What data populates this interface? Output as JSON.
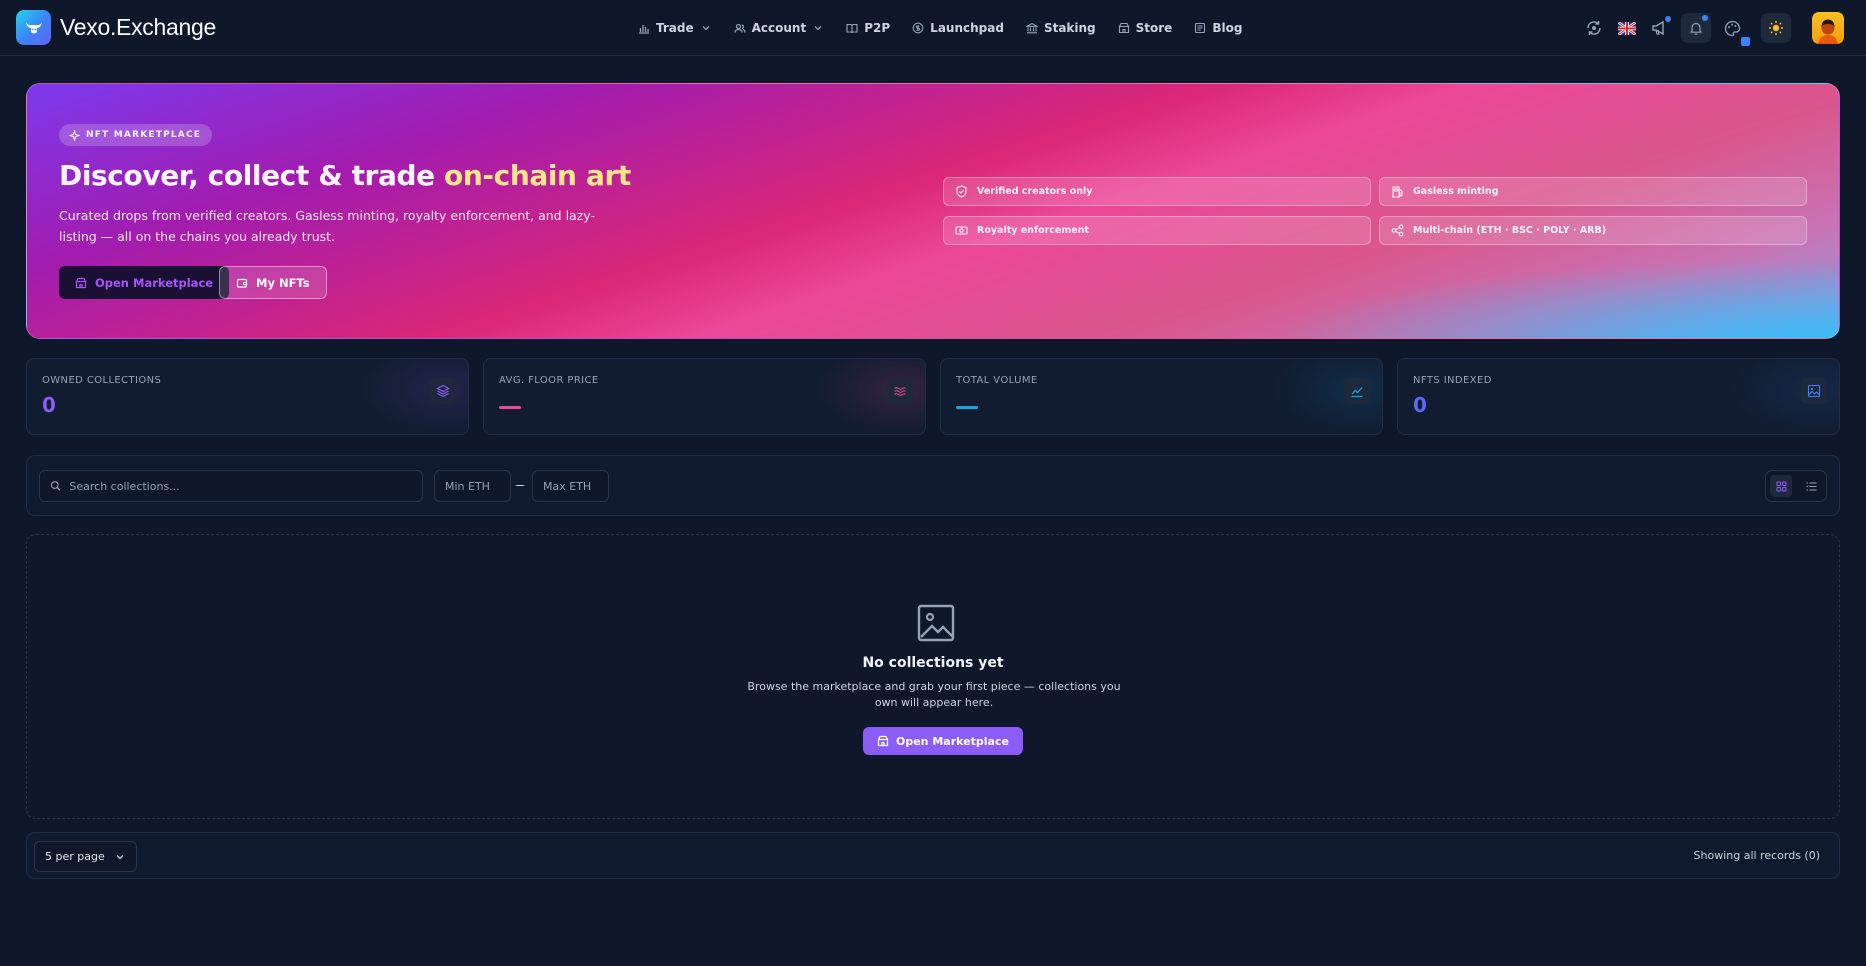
{
  "brand": {
    "name": "Vexo.Exchange"
  },
  "nav": {
    "items": [
      {
        "label": "Trade",
        "icon": "bar-chart-icon",
        "dropdown": true
      },
      {
        "label": "Account",
        "icon": "users-icon",
        "dropdown": true
      },
      {
        "label": "P2P",
        "icon": "book-icon",
        "dropdown": false
      },
      {
        "label": "Launchpad",
        "icon": "coin-icon",
        "dropdown": false
      },
      {
        "label": "Staking",
        "icon": "bank-icon",
        "dropdown": false
      },
      {
        "label": "Store",
        "icon": "store-icon",
        "dropdown": false
      },
      {
        "label": "Blog",
        "icon": "newspaper-icon",
        "dropdown": false
      }
    ],
    "right_icons": [
      "refresh-icon",
      "uk-flag-icon",
      "megaphone-icon",
      "bell-icon",
      "palette-icon",
      "sun-icon",
      "avatar"
    ]
  },
  "hero": {
    "badge": "NFT MARKETPLACE",
    "title_prefix": "Discover, collect & trade ",
    "title_highlight": "on-chain art",
    "description": "Curated drops from verified creators. Gasless minting, royalty enforcement, and lazy-listing — all on the chains you already trust.",
    "primary_button": "Open Marketplace",
    "secondary_button": "My NFTs",
    "features": [
      {
        "label": "Verified creators only",
        "icon": "shield-check-icon"
      },
      {
        "label": "Gasless minting",
        "icon": "gas-pump-icon"
      },
      {
        "label": "Royalty enforcement",
        "icon": "money-icon"
      },
      {
        "label": "Multi-chain (ETH · BSC · POLY · ARB)",
        "icon": "share-nodes-icon"
      }
    ]
  },
  "stats": [
    {
      "label": "OWNED COLLECTIONS",
      "value": "0",
      "color": "#8b5cf6",
      "icon": "layers-icon"
    },
    {
      "label": "AVG. FLOOR PRICE",
      "value": "",
      "color": "#ec4899",
      "icon": "waves-icon"
    },
    {
      "label": "TOTAL VOLUME",
      "value": "",
      "color": "#0ea5e9",
      "icon": "trend-chart-icon"
    },
    {
      "label": "NFTS INDEXED",
      "value": "0",
      "color": "#6366f1",
      "icon": "image-icon"
    }
  ],
  "filters": {
    "search_placeholder": "Search collections...",
    "min_placeholder": "Min ETH",
    "max_placeholder": "Max ETH",
    "view_mode": "grid"
  },
  "empty": {
    "title": "No collections yet",
    "description": "Browse the marketplace and grab your first piece — collections you own will appear here.",
    "button": "Open Marketplace"
  },
  "pagination": {
    "per_page": "5 per page",
    "records": "Showing all records (0)"
  },
  "colors": {
    "accent": "#8b5cf6",
    "highlight": "#fde68a",
    "background": "#0f172a"
  }
}
